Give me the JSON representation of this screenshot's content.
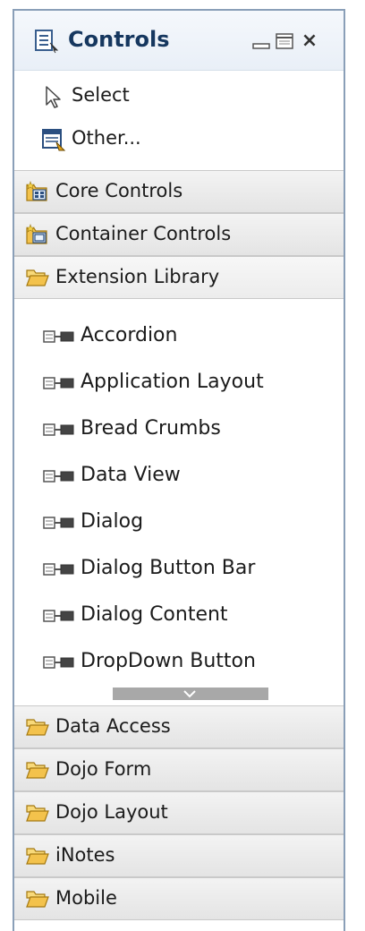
{
  "panel": {
    "title": "Controls",
    "close_glyph": "×"
  },
  "tools": [
    {
      "label": "Select",
      "icon": "arrow-cursor-icon"
    },
    {
      "label": "Other...",
      "icon": "other-control-icon"
    }
  ],
  "drawers_top": [
    {
      "label": "Core Controls",
      "icon": "core-controls-folder-icon"
    },
    {
      "label": "Container Controls",
      "icon": "container-controls-folder-icon"
    },
    {
      "label": "Extension Library",
      "icon": "open-folder-icon"
    }
  ],
  "extension_items": [
    {
      "label": "Accordion"
    },
    {
      "label": "Application Layout"
    },
    {
      "label": "Bread Crumbs"
    },
    {
      "label": "Data View"
    },
    {
      "label": "Dialog"
    },
    {
      "label": "Dialog Button Bar"
    },
    {
      "label": "Dialog Content"
    },
    {
      "label": "DropDown Button"
    }
  ],
  "drawers_bottom": [
    {
      "label": "Data Access"
    },
    {
      "label": "Dojo Form"
    },
    {
      "label": "Dojo Layout"
    },
    {
      "label": "iNotes"
    },
    {
      "label": "Mobile"
    }
  ],
  "colors": {
    "panel_border": "#8a9fb8",
    "title_text": "#16375f",
    "folder_yellow": "#f3c24c"
  }
}
